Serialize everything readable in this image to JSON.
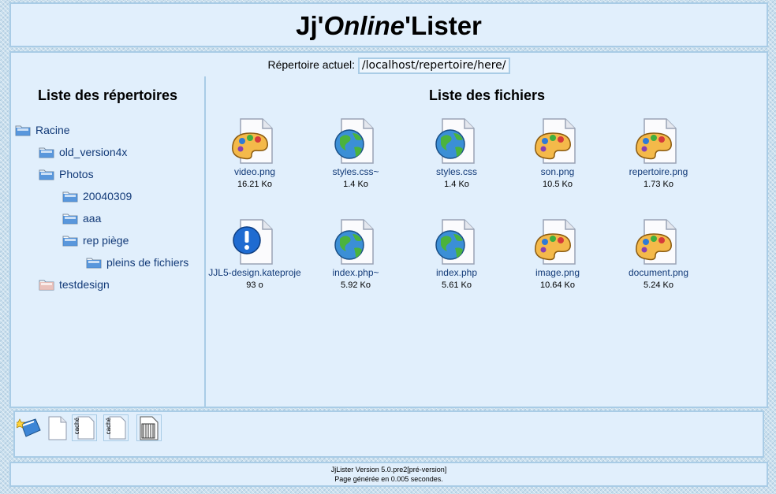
{
  "header": {
    "title_part1": "Jj'",
    "title_part2": "Online",
    "title_part3": "'Lister"
  },
  "current_dir": {
    "label": "Répertoire actuel:",
    "value": "/localhost/repertoire/here/"
  },
  "dirs": {
    "title": "Liste des répertoires",
    "items": [
      {
        "label": "Racine",
        "level": 0
      },
      {
        "label": "old_version4x",
        "level": 1
      },
      {
        "label": "Photos",
        "level": 1
      },
      {
        "label": "20040309",
        "level": 2
      },
      {
        "label": "aaa",
        "level": 2
      },
      {
        "label": "rep piège",
        "level": 2
      },
      {
        "label": "pleins de fichiers",
        "level": 3
      },
      {
        "label": "testdesign",
        "level": 1
      }
    ]
  },
  "files": {
    "title": "Liste des fichiers",
    "items": [
      {
        "name": "video.png",
        "size": "16.21 Ko",
        "icon": "palette-icon"
      },
      {
        "name": "styles.css~",
        "size": "1.4 Ko",
        "icon": "globe-icon"
      },
      {
        "name": "styles.css",
        "size": "1.4 Ko",
        "icon": "globe-icon"
      },
      {
        "name": "son.png",
        "size": "10.5 Ko",
        "icon": "palette-icon"
      },
      {
        "name": "repertoire.png",
        "size": "1.73 Ko",
        "icon": "palette-icon"
      },
      {
        "name": "JJL5-design.kateproje",
        "size": "93 o",
        "icon": "info-icon"
      },
      {
        "name": "index.php~",
        "size": "5.92 Ko",
        "icon": "globe-icon"
      },
      {
        "name": "index.php",
        "size": "5.61 Ko",
        "icon": "globe-icon"
      },
      {
        "name": "image.png",
        "size": "10.64 Ko",
        "icon": "palette-icon"
      },
      {
        "name": "document.png",
        "size": "5.24 Ko",
        "icon": "palette-icon"
      }
    ]
  },
  "toolbar": {
    "items": [
      {
        "name": "new-folder-icon",
        "label": ""
      },
      {
        "name": "new-file-icon",
        "label": ""
      },
      {
        "name": "hidden-file-icon",
        "label": "caché"
      },
      {
        "name": "hidden-folder-icon",
        "label": "caché"
      },
      {
        "name": "archive-icon",
        "label": ""
      }
    ]
  },
  "footer": {
    "version": "JjLister Version 5.0.pre2[pré-version]",
    "generated": "Page générée en 0.005 secondes."
  },
  "colors": {
    "panel_bg": "#e1effc",
    "panel_border": "#a9cce6",
    "link": "#123a78"
  }
}
